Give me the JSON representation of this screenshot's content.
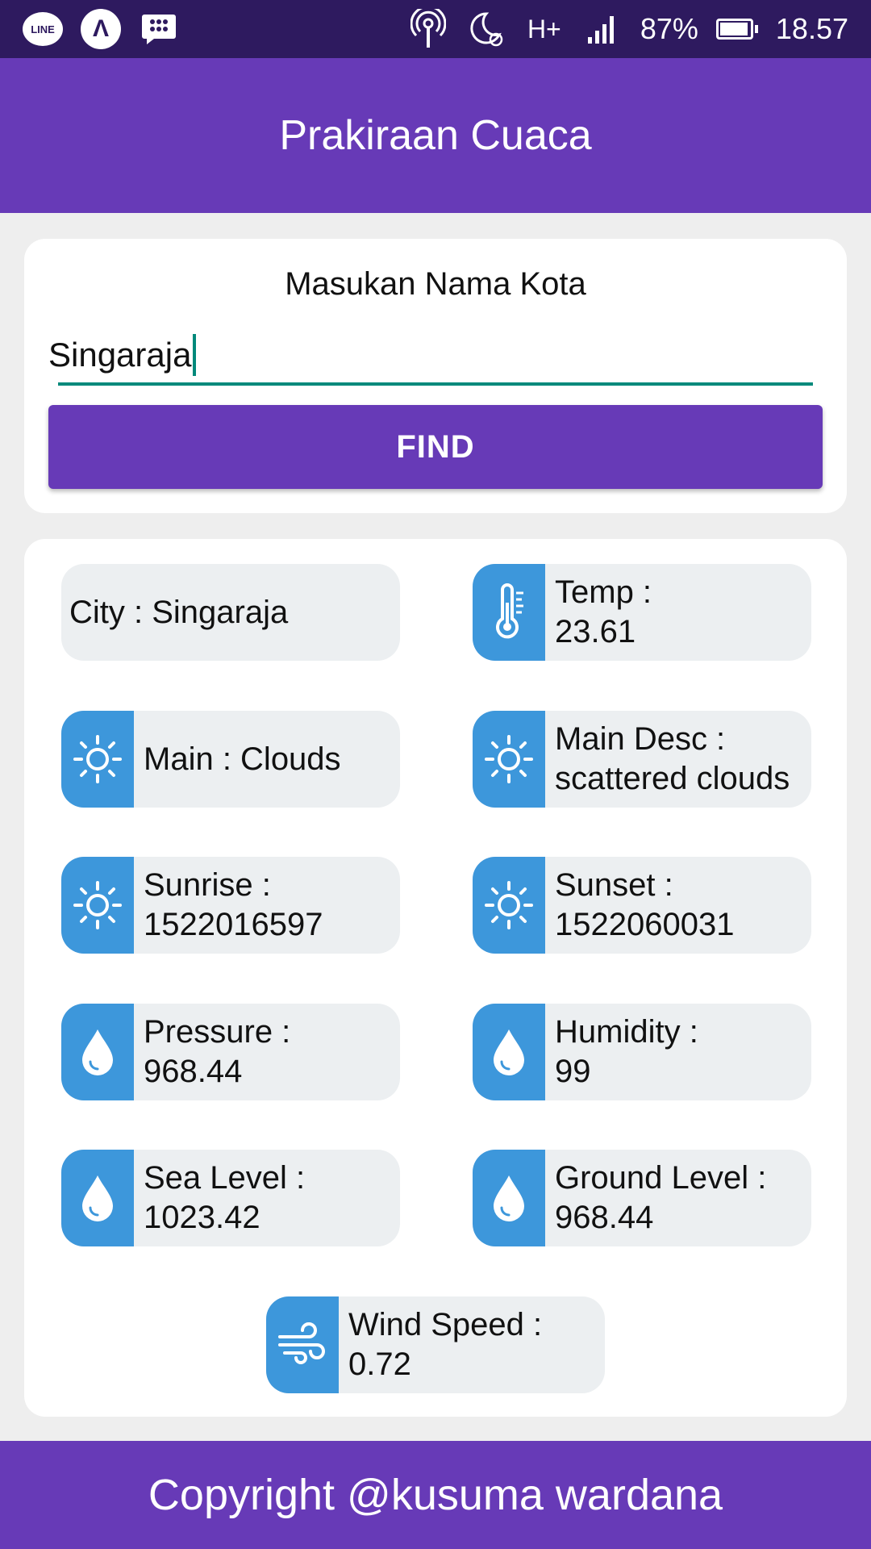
{
  "status_bar": {
    "line_label": "LINE",
    "battery": "87%",
    "time": "18.57",
    "network": "H+"
  },
  "app_bar": {
    "title": "Prakiraan Cuaca"
  },
  "search": {
    "label": "Masukan Nama Kota",
    "value": "Singaraja",
    "button_label": "FIND"
  },
  "results": {
    "city": {
      "label": "City : Singaraja"
    },
    "temp": {
      "label": "Temp :",
      "value": "23.61",
      "icon": "thermometer-icon"
    },
    "main": {
      "label": "Main : Clouds",
      "icon": "sun-icon"
    },
    "main_desc": {
      "label": "Main Desc :",
      "value": "scattered clouds",
      "icon": "sun-icon"
    },
    "sunrise": {
      "label": "Sunrise :",
      "value": "1522016597",
      "icon": "sun-icon"
    },
    "sunset": {
      "label": "Sunset :",
      "value": "1522060031",
      "icon": "sun-icon"
    },
    "pressure": {
      "label": "Pressure :",
      "value": "968.44",
      "icon": "water-drop-icon"
    },
    "humidity": {
      "label": "Humidity :",
      "value": "99",
      "icon": "water-drop-icon"
    },
    "sea_level": {
      "label": "Sea Level :",
      "value": "1023.42",
      "icon": "water-drop-icon"
    },
    "ground_level": {
      "label": "Ground Level :",
      "value": "968.44",
      "icon": "water-drop-icon"
    },
    "wind_speed": {
      "label": "Wind Speed :",
      "value": "0.72",
      "icon": "wind-icon"
    }
  },
  "footer": {
    "text": "Copyright @kusuma wardana"
  },
  "colors": {
    "primary": "#673ab7",
    "status_bar": "#2e1a5f",
    "icon_tile": "#3d97db",
    "accent": "#00897b",
    "tile_bg": "#eceff1"
  }
}
